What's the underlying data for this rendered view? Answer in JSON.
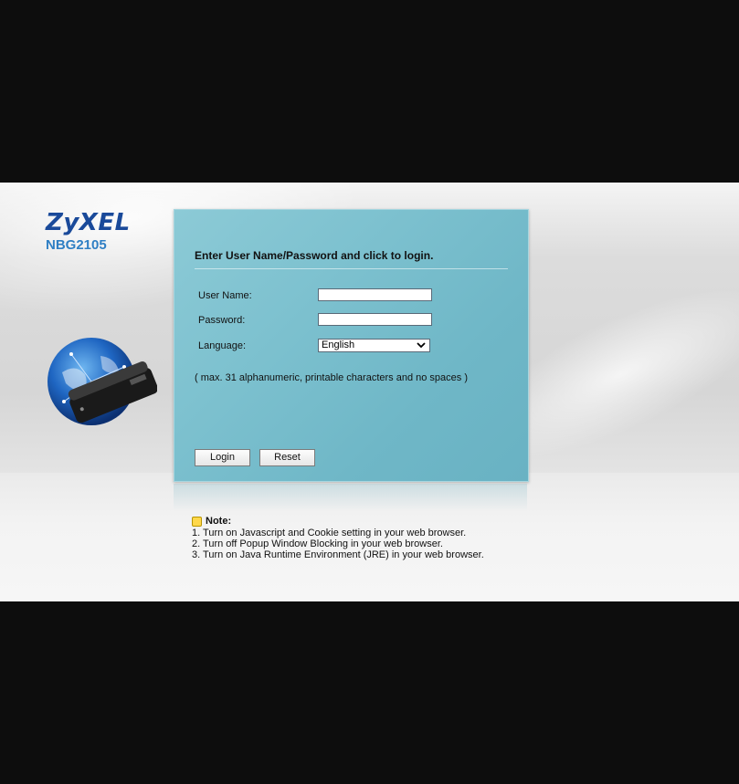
{
  "brand": {
    "logo": "ZyXEL",
    "model": "NBG2105"
  },
  "login": {
    "title": "Enter User Name/Password and click to login.",
    "username_label": "User Name:",
    "username_value": "",
    "password_label": "Password:",
    "password_value": "",
    "language_label": "Language:",
    "language_selected": "English",
    "hint": "( max. 31 alphanumeric, printable characters and no spaces )",
    "login_button": "Login",
    "reset_button": "Reset"
  },
  "note": {
    "title": "Note:",
    "items": [
      "1. Turn on Javascript and Cookie setting in your web browser.",
      "2. Turn off Popup Window Blocking in your web browser.",
      "3. Turn on Java Runtime Environment (JRE) in your web browser."
    ]
  },
  "colors": {
    "panel": "#7dc1cf",
    "logo": "#1a4a9a",
    "model": "#2f7fc4",
    "background": "#0d0d0d"
  },
  "icons": [
    "globe-router-image",
    "note-icon",
    "chevron-down-icon"
  ]
}
